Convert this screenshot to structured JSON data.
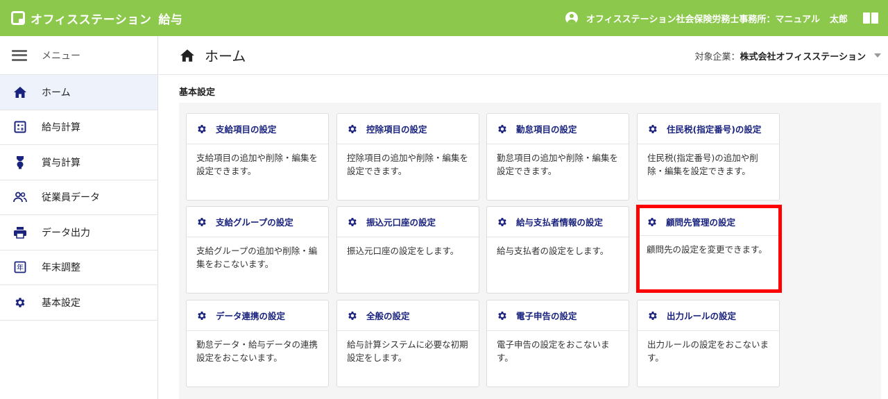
{
  "header": {
    "brand": "オフィスステーション",
    "brand_product": "給与",
    "user_office": "オフィスステーション社会保険労務士事務所：マニュアル",
    "user_given": "太郎",
    "color": "#8cc84b"
  },
  "sidebar": {
    "menu_label": "メニュー",
    "items": [
      {
        "label": "ホーム",
        "icon": "home-icon",
        "active": true
      },
      {
        "label": "給与計算",
        "icon": "calculator-icon",
        "active": false
      },
      {
        "label": "賞与計算",
        "icon": "award-icon",
        "active": false
      },
      {
        "label": "従業員データ",
        "icon": "people-icon",
        "active": false
      },
      {
        "label": "データ出力",
        "icon": "printer-icon",
        "active": false
      },
      {
        "label": "年末調整",
        "icon": "year-end-icon",
        "active": false
      },
      {
        "label": "基本設定",
        "icon": "gear-icon",
        "active": false
      }
    ]
  },
  "page": {
    "title": "ホーム",
    "company_label": "対象企業：",
    "company_name": "株式会社オフィスステーション",
    "section_title": "基本設定"
  },
  "cards": [
    {
      "title": "支給項目の設定",
      "desc": "支給項目の追加や削除・編集を設定できます。"
    },
    {
      "title": "控除項目の設定",
      "desc": "控除項目の追加や削除・編集を設定できます。"
    },
    {
      "title": "勤怠項目の設定",
      "desc": "勤怠項目の追加や削除・編集を設定できます。"
    },
    {
      "title": "住民税(指定番号)の設定",
      "desc": "住民税(指定番号)の追加や削除・編集を設定できます。"
    },
    {
      "title": "支給グループの設定",
      "desc": "支給グループの追加や削除・編集をおこないます。"
    },
    {
      "title": "振込元口座の設定",
      "desc": "振込元口座の設定をします。"
    },
    {
      "title": "給与支払者情報の設定",
      "desc": "給与支払者の設定をします。"
    },
    {
      "title": "顧問先管理の設定",
      "desc": "顧問先の設定を変更できます。",
      "highlighted": true
    },
    {
      "title": "データ連携の設定",
      "desc": "勤怠データ・給与データの連携設定をおこないます。"
    },
    {
      "title": "全般の設定",
      "desc": "給与計算システムに必要な初期設定をします。"
    },
    {
      "title": "電子申告の設定",
      "desc": "電子申告の設定をおこないます。"
    },
    {
      "title": "出力ルールの設定",
      "desc": "出力ルールの設定をおこないます。"
    }
  ]
}
